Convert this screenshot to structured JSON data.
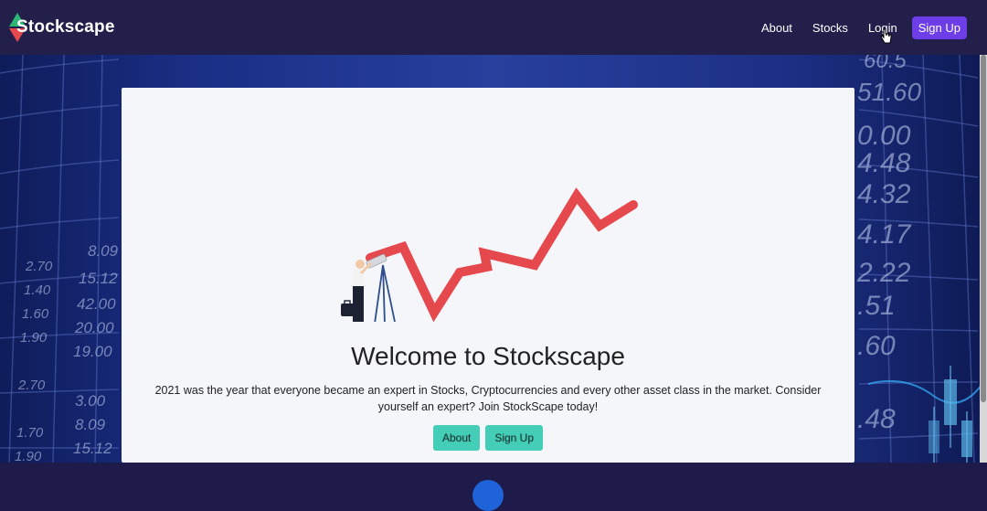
{
  "navbar": {
    "brand": "Stockscape",
    "links": [
      "About",
      "Stocks",
      "Login"
    ],
    "signup_label": "Sign Up"
  },
  "hero": {
    "bg_numbers_left": [
      "8.09",
      "15.12",
      "42.00",
      "20.00",
      "19.00",
      "3.00",
      "8.09",
      "15.12"
    ],
    "bg_numbers_left_inner": [
      "2.70",
      "1.40",
      "1.60",
      "1.90",
      "2.70",
      "1.70",
      "1.90"
    ],
    "bg_numbers_right": [
      "60.5",
      "51.60",
      "0.00",
      "4.48",
      "4.32",
      "4.17",
      "2.22",
      ".51",
      ".60",
      ".48"
    ]
  },
  "card": {
    "headline": "Welcome to Stockscape",
    "paragraph": "2021 was the year that everyone became an expert in Stocks, Cryptocurrencies and every other asset class in the market. Consider yourself an expert? Join StockScape today!",
    "about_button": "About",
    "signup_button": "Sign Up"
  },
  "colors": {
    "navbar": "#221f4a",
    "accent_purple": "#6d3ee8",
    "teal_button": "#44cdb7",
    "chart_line": "#e5484d"
  }
}
